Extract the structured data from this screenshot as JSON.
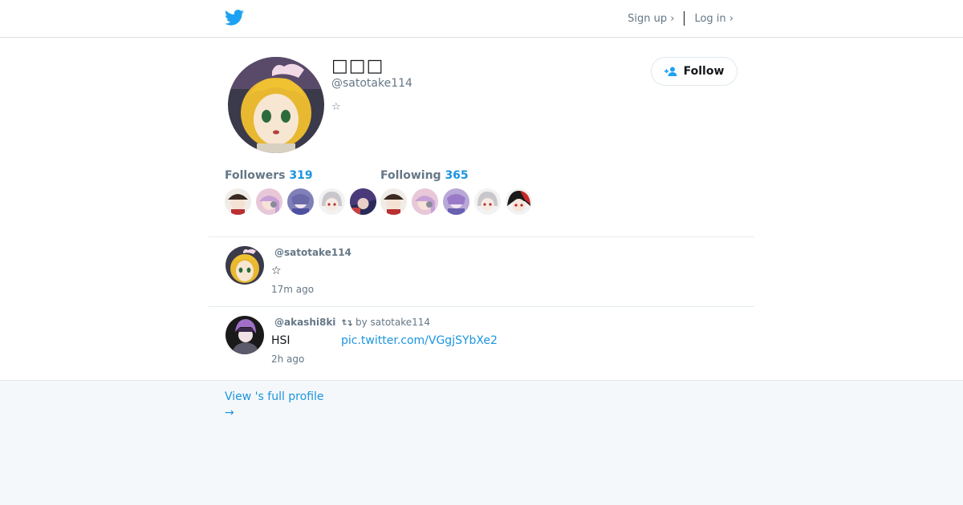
{
  "header": {
    "sign_up_label": "Sign up ›",
    "log_in_label": "Log in ›"
  },
  "profile": {
    "name": "□□□",
    "handle": "@satotake114",
    "bio": "☆",
    "follow_label": "Follow"
  },
  "stats": {
    "followers_label": "Followers",
    "followers_count": "319",
    "following_label": "Following",
    "following_count": "365"
  },
  "tweets": [
    {
      "user": "@satotake114",
      "retweet": "",
      "text": "☆",
      "link": "",
      "time": "17m ago"
    },
    {
      "user": "@akashi8ki",
      "retweet": "by satotake114",
      "text": "HSI",
      "link": "pic.twitter.com/VGgjSYbXe2",
      "time": "2h ago"
    }
  ],
  "footer": {
    "view_profile_label": "View 's full profile",
    "arrow": "→"
  },
  "colors": {
    "accent": "#1b95e0",
    "twitter_blue": "#1da1f2",
    "muted": "#657786",
    "footer_bg": "#f5f8fa"
  }
}
